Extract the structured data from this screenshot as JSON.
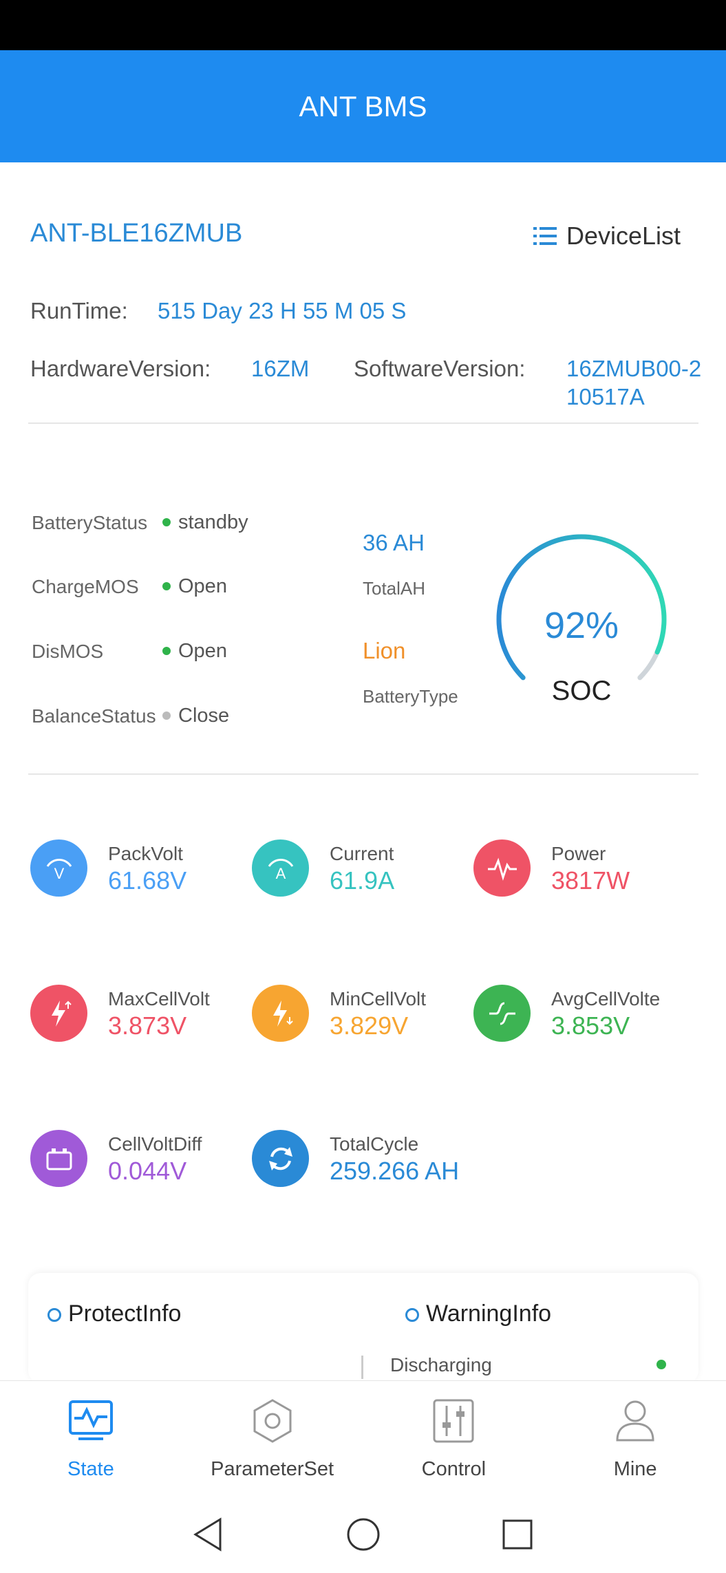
{
  "app": {
    "title": "ANT BMS"
  },
  "device": {
    "name": "ANT-BLE16ZMUB",
    "device_list_label": "DeviceList",
    "runtime_label": "RunTime:",
    "runtime_value": "515 Day 23 H 55 M 05 S",
    "hardware_label": "HardwareVersion:",
    "hardware_value": "16ZM",
    "software_label": "SoftwareVersion:",
    "software_value_line1": "16ZMUB00-2",
    "software_value_line2": "10517A"
  },
  "status": {
    "battery_status_label": "BatteryStatus",
    "battery_status_value": "standby",
    "charge_mos_label": "ChargeMOS",
    "charge_mos_value": "Open",
    "dis_mos_label": "DisMOS",
    "dis_mos_value": "Open",
    "balance_status_label": "BalanceStatus",
    "balance_status_value": "Close",
    "total_ah_value": "36 AH",
    "total_ah_label": "TotalAH",
    "battery_type_value": "Lion",
    "battery_type_label": "BatteryType",
    "soc_value": "92%",
    "soc_label": "SOC",
    "soc_fraction": 0.92
  },
  "metrics": [
    {
      "label": "PackVolt",
      "value": "61.68V",
      "color": "#4a9ff5",
      "icon": "gauge-v-icon"
    },
    {
      "label": "Current",
      "value": "61.9A",
      "color": "#36c3c0",
      "icon": "gauge-a-icon"
    },
    {
      "label": "Power",
      "value": "3817W",
      "color": "#ef5366",
      "icon": "pulse-icon"
    },
    {
      "label": "MaxCellVolt",
      "value": "3.873V",
      "color": "#ef5366",
      "icon": "bolt-up-icon"
    },
    {
      "label": "MinCellVolt",
      "value": "3.829V",
      "color": "#f7a531",
      "icon": "bolt-down-icon"
    },
    {
      "label": "AvgCellVolte",
      "value": "3.853V",
      "color": "#3db453",
      "icon": "wave-icon"
    },
    {
      "label": "CellVoltDiff",
      "value": "0.044V",
      "color": "#a05ad8",
      "icon": "battery-icon"
    },
    {
      "label": "TotalCycle",
      "value": "259.266 AH",
      "color": "#2a8ad6",
      "icon": "cycle-icon"
    }
  ],
  "info": {
    "protect_label": "ProtectInfo",
    "warning_label": "WarningInfo",
    "warning_item": "Discharging"
  },
  "tabs": [
    {
      "label": "State"
    },
    {
      "label": "ParameterSet"
    },
    {
      "label": "Control"
    },
    {
      "label": "Mine"
    }
  ]
}
